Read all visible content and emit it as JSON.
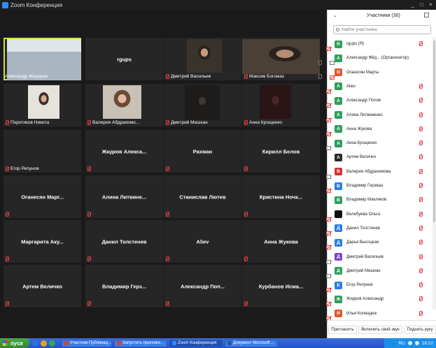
{
  "window": {
    "title": "Zoom Конференция"
  },
  "tiles": [
    {
      "name": "Александр Фёдоров",
      "video": true,
      "muted": false,
      "active": true
    },
    {
      "name": "rgups",
      "video": false,
      "muted": false
    },
    {
      "name": "Дмитрий Васильев",
      "video": true,
      "muted": true
    },
    {
      "name": "Максим Богомаз",
      "video": true,
      "muted": true
    },
    {
      "name": "Поротиков Никита",
      "video": true,
      "muted": true
    },
    {
      "name": "Валерия Абдрахимо...",
      "video": true,
      "muted": true
    },
    {
      "name": "Дмитрий Мешкан",
      "video": true,
      "muted": true
    },
    {
      "name": "Анна Крощенко",
      "video": true,
      "muted": true
    },
    {
      "name": "Егор Репунов",
      "video": false,
      "muted": true,
      "corner_only": true
    },
    {
      "name": "Жидков Алекса...",
      "video": false,
      "muted": true
    },
    {
      "name": "Рахман",
      "video": false,
      "muted": true
    },
    {
      "name": "Кирилл Белов",
      "video": false,
      "muted": true
    },
    {
      "name": "Оганесян Марг...",
      "video": false,
      "muted": true
    },
    {
      "name": "Алина Литвине...",
      "video": false,
      "muted": true
    },
    {
      "name": "Станислав Лютев",
      "video": false,
      "muted": true
    },
    {
      "name": "Кристина Ночк...",
      "video": false,
      "muted": true
    },
    {
      "name": "Маргарита Аку...",
      "video": false,
      "muted": true
    },
    {
      "name": "Данил Толстенев",
      "video": false,
      "muted": true
    },
    {
      "name": "Aliev",
      "video": false,
      "muted": true
    },
    {
      "name": "Анна Жукова",
      "video": false,
      "muted": true
    },
    {
      "name": "Артем Величко",
      "video": false,
      "muted": true
    },
    {
      "name": "Владимир Герз...",
      "video": false,
      "muted": true
    },
    {
      "name": "Александр Поп...",
      "video": false,
      "muted": true
    },
    {
      "name": "Курбанов Исма...",
      "video": false,
      "muted": true
    }
  ],
  "participants_panel": {
    "title": "Участники (30)",
    "search_placeholder": "Найти участника",
    "items": [
      {
        "initial": "R",
        "color": "#2f9e5a",
        "name": "rgups (Я)",
        "mic": "off",
        "cam": "off"
      },
      {
        "initial": "А",
        "color": "#2f9e5a",
        "name": "Александр Фёд... (Организатор)",
        "mic": "on",
        "cam": "on"
      },
      {
        "initial": "О",
        "color": "#e0582b",
        "name": "Оганесян Марты",
        "mic": "on",
        "cam": "off"
      },
      {
        "initial": "A",
        "color": "#2f9e5a",
        "name": "Aliev",
        "mic": "off",
        "cam": "off"
      },
      {
        "initial": "А",
        "color": "#2f9e5a",
        "name": "Александр Попов",
        "mic": "off",
        "cam": "off"
      },
      {
        "initial": "А",
        "color": "#2f9e5a",
        "name": "Алина Литвиненко",
        "mic": "off",
        "cam": "off"
      },
      {
        "initial": "А",
        "color": "#2f9e5a",
        "name": "Анна Жукова",
        "mic": "off",
        "cam": "off"
      },
      {
        "initial": "А",
        "color": "#2f9e5a",
        "name": "Анна Крощенко",
        "mic": "off",
        "cam": "on"
      },
      {
        "initial": "А",
        "color": "#2a2a2a",
        "name": "Артем Величко",
        "mic": "off",
        "cam": "none"
      },
      {
        "initial": "В",
        "color": "#d0342c",
        "name": "Валерия Абдрахимова",
        "mic": "off",
        "cam": "on"
      },
      {
        "initial": "В",
        "color": "#2a7de1",
        "name": "Владимир Герзваа",
        "mic": "off",
        "cam": "off"
      },
      {
        "initial": "В",
        "color": "#2f9e5a",
        "name": "Владимир Макляков",
        "mic": "off",
        "cam": "none"
      },
      {
        "initial": "",
        "color": "#111111",
        "name": "Велебуева Ольга",
        "mic": "off",
        "cam": "off"
      },
      {
        "initial": "Д",
        "color": "#2a7de1",
        "name": "Данил Толстенев",
        "mic": "off",
        "cam": "off"
      },
      {
        "initial": "Д",
        "color": "#2a7de1",
        "name": "Дарья Высоцкая",
        "mic": "off",
        "cam": "off"
      },
      {
        "initial": "Д",
        "color": "#7a45c9",
        "name": "Дмитрий Васильев",
        "mic": "off",
        "cam": "on"
      },
      {
        "initial": "Д",
        "color": "#2f9e5a",
        "name": "Дмитрий Мешкан",
        "mic": "off",
        "cam": "on"
      },
      {
        "initial": "Е",
        "color": "#2a7de1",
        "name": "Егор Репунов",
        "mic": "off",
        "cam": "off"
      },
      {
        "initial": "Ж",
        "color": "#2f9e5a",
        "name": "Жидков Александр",
        "mic": "off",
        "cam": "off"
      },
      {
        "initial": "И",
        "color": "#e0582b",
        "name": "Илья Копендюк",
        "mic": "off",
        "cam": "off"
      }
    ],
    "footer": {
      "invite": "Пригласить",
      "mute_all": "Включить свой звук",
      "raise_hand": "Поднять руку"
    }
  },
  "taskbar": {
    "start": "пуск",
    "tasks": [
      {
        "label": "Участник Публикац...",
        "icon_color": "#d8402a"
      },
      {
        "label": "Запустить приложе...",
        "icon_color": "#d8402a"
      },
      {
        "label": "Zoom Конференция",
        "icon_color": "#2d8cff",
        "active": true
      },
      {
        "label": "Документ Microsoft ...",
        "icon_color": "#2b579a"
      }
    ],
    "lang": "RU",
    "time": "18:22"
  }
}
